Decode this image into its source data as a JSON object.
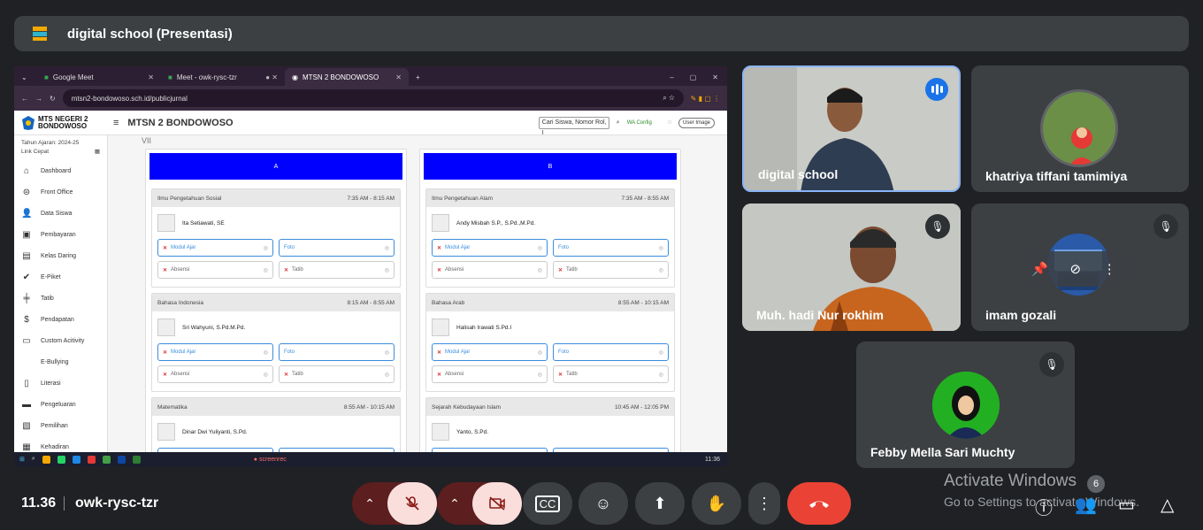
{
  "meeting": {
    "title": "digital school (Presentasi)",
    "time": "11.36",
    "code": "owk-rysc-tzr"
  },
  "browser": {
    "tabs": [
      {
        "label": "Google Meet"
      },
      {
        "label": "Meet - owk-rysc-tzr"
      },
      {
        "label": "MTSN 2 BONDOWOSO"
      }
    ],
    "url": "mtsn2-bondowoso.sch.id/publicjurnal"
  },
  "site": {
    "logo_line1": "MTS NEGERI 2",
    "logo_line2": "BONDOWOSO",
    "title": "MTSN 2 BONDOWOSO",
    "search_placeholder": "Cari Siswa, Nomor Rol, I",
    "wa_config": "WA Config",
    "user_image": "User Image",
    "tahun_ajaran": "Tahun Ajaran: 2024-25",
    "link_cepat": "Link Cepat",
    "kelas": "VII",
    "menu": [
      {
        "label": "Dashboard",
        "icon": "home-icon",
        "glyph": "⌂"
      },
      {
        "label": "Front Office",
        "icon": "globe-icon",
        "glyph": "⊜"
      },
      {
        "label": "Data Siswa",
        "icon": "user-add-icon",
        "glyph": "👤"
      },
      {
        "label": "Pembayaran",
        "icon": "money-icon",
        "glyph": "▣"
      },
      {
        "label": "Kelas Daring",
        "icon": "document-icon",
        "glyph": "▤"
      },
      {
        "label": "E-Piket",
        "icon": "check-icon",
        "glyph": "✔"
      },
      {
        "label": "Tatib",
        "icon": "signpost-icon",
        "glyph": "╪"
      },
      {
        "label": "Pendapatan",
        "icon": "dollar-icon",
        "glyph": "$"
      },
      {
        "label": "Custom Acitivity",
        "icon": "briefcase-icon",
        "glyph": "▭"
      },
      {
        "label": "E-Bullying",
        "icon": "none",
        "glyph": ""
      },
      {
        "label": "Literasi",
        "icon": "book-icon",
        "glyph": "▯"
      },
      {
        "label": "Pengeluaran",
        "icon": "card-icon",
        "glyph": "▬"
      },
      {
        "label": "Pemilihan",
        "icon": "map-icon",
        "glyph": "▧"
      },
      {
        "label": "Kehadiran",
        "icon": "calendar-icon",
        "glyph": "▦"
      }
    ],
    "columns": [
      {
        "label": "A",
        "lessons": [
          {
            "subject": "Ilmu Pengetahuan Sosial",
            "time": "7:35 AM - 8:15 AM",
            "teacher": "Ita Setiawati, SE"
          },
          {
            "subject": "Bahasa Indonesia",
            "time": "8:15 AM - 8:55 AM",
            "teacher": "Sri Wahyuni, S.Pd.M.Pd."
          },
          {
            "subject": "Matematika",
            "time": "8:55 AM - 10:15 AM",
            "teacher": "Dinar Dwi Yuliyanti, S.Pd."
          }
        ]
      },
      {
        "label": "B",
        "lessons": [
          {
            "subject": "Ilmu Pengetahuan Alam",
            "time": "7:35 AM - 8:55 AM",
            "teacher": "Andy Misbah S.P., S.Pd.,M.Pd."
          },
          {
            "subject": "Bahasa Arab",
            "time": "8:55 AM - 10:15 AM",
            "teacher": "Halisah Irawati S.Pd.I"
          },
          {
            "subject": "Sejarah Kebudayaan Islam",
            "time": "10:45 AM - 12:05 PM",
            "teacher": "Yanto, S.Pd."
          }
        ]
      }
    ],
    "buttons": {
      "modul": "Modul Ajar",
      "foto": "Foto",
      "absensi": "Absensi",
      "tatib": "Tatib"
    },
    "taskbar_time": "11:36",
    "screenrec": "screenrec"
  },
  "participants": [
    {
      "name": "digital school",
      "speaking": true
    },
    {
      "name": "khatriya tiffani tamimiya"
    },
    {
      "name": "Muh. hadi Nur rokhim",
      "muted": true
    },
    {
      "name": "imam gozali",
      "muted": true
    },
    {
      "name": "Febby Mella Sari Muchty",
      "muted": true
    }
  ],
  "windows_notice": {
    "line1": "Activate Windows",
    "line2": "Go to Settings to activate Windows.",
    "badge": "6"
  },
  "colors": {
    "hangup": "#ea4335",
    "muted_bg": "#f9dedc",
    "accent": "#1a73e8"
  }
}
